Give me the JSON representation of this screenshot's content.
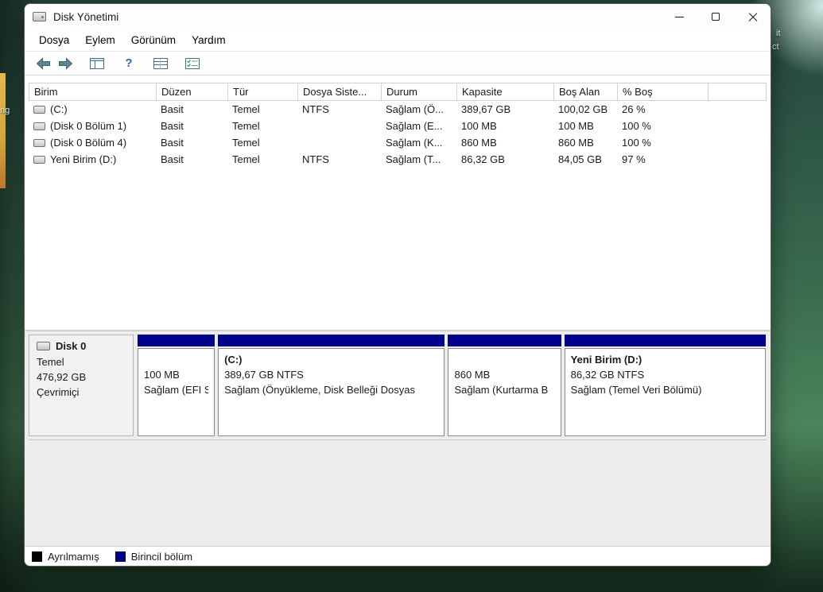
{
  "desktop": {
    "fragment_top_right_1": "it",
    "fragment_top_right_2": "ct",
    "fragment_left": "ng"
  },
  "window": {
    "title": "Disk Yönetimi",
    "menu": [
      "Dosya",
      "Eylem",
      "Görünüm",
      "Yardım"
    ]
  },
  "table": {
    "columns": [
      "Birim",
      "Düzen",
      "Tür",
      "Dosya Siste...",
      "Durum",
      "Kapasite",
      "Boş Alan",
      "% Boş"
    ],
    "rows": [
      [
        "(C:)",
        "Basit",
        "Temel",
        "NTFS",
        "Sağlam (Ö...",
        "389,67 GB",
        "100,02 GB",
        "26 %"
      ],
      [
        "(Disk 0 Bölüm 1)",
        "Basit",
        "Temel",
        "",
        "Sağlam (E...",
        "100 MB",
        "100 MB",
        "100 %"
      ],
      [
        "(Disk 0 Bölüm 4)",
        "Basit",
        "Temel",
        "",
        "Sağlam (K...",
        "860 MB",
        "860 MB",
        "100 %"
      ],
      [
        "Yeni Birim (D:)",
        "Basit",
        "Temel",
        "NTFS",
        "Sağlam (T...",
        "86,32 GB",
        "84,05 GB",
        "97 %"
      ]
    ]
  },
  "disk": {
    "name": "Disk 0",
    "type": "Temel",
    "size": "476,92 GB",
    "status": "Çevrimiçi",
    "partitions": [
      {
        "name": "",
        "size": "100 MB",
        "status": "Sağlam (EFI S"
      },
      {
        "name": "(C:)",
        "size": "389,67 GB NTFS",
        "status": "Sağlam (Önyükleme, Disk Belleği Dosyas"
      },
      {
        "name": "",
        "size": "860 MB",
        "status": "Sağlam (Kurtarma B"
      },
      {
        "name": "Yeni Birim  (D:)",
        "size": "86,32 GB NTFS",
        "status": "Sağlam (Temel Veri Bölümü)"
      }
    ]
  },
  "legend": {
    "items": [
      {
        "label": "Ayrılmamış",
        "color": "#000000"
      },
      {
        "label": "Birincil bölüm",
        "color": "#00008b"
      }
    ]
  },
  "colors": {
    "primary_partition_navy": "#00008b",
    "toolbar_icon_teal": "#5e8794",
    "help_blue": "#2b66c4"
  }
}
